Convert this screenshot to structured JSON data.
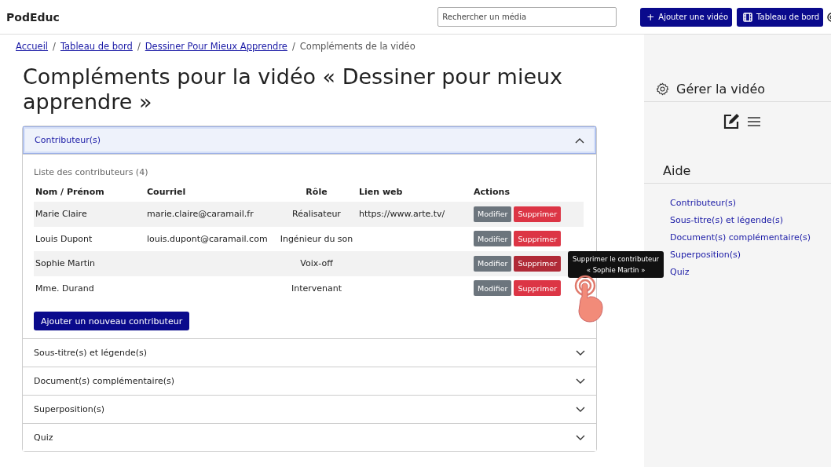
{
  "header": {
    "brand": "PodEduc",
    "search": {
      "placeholder": "Rechercher un média"
    },
    "buttons": [
      {
        "kind": "add",
        "icon": "+",
        "label": "Ajouter une vidéo"
      },
      {
        "kind": "dashboard",
        "label": "Tableau de bord"
      }
    ]
  },
  "breadcrumb": [
    {
      "label": "Accueil",
      "link": true
    },
    {
      "separator": "/",
      "label": "Tableau de bord",
      "link": true
    },
    {
      "separator": "/",
      "label": "Dessiner Pour Mieux Apprendre",
      "link": true
    },
    {
      "separator": "/",
      "label": "Compléments de la vidéo",
      "link": false
    }
  ],
  "title": "Compléments pour la vidéo « Dessiner pour mieux apprendre »",
  "accordion": [
    {
      "label": "Contributeur(s)",
      "expanded": true
    },
    {
      "label": "Sous-titre(s) et légende(s)",
      "expanded": false
    },
    {
      "label": "Document(s) complémentaire(s)",
      "expanded": false
    },
    {
      "label": "Superposition(s)",
      "expanded": false
    },
    {
      "label": "Quiz",
      "expanded": false
    }
  ],
  "contributors": {
    "caption": "Liste des contributeurs (4)",
    "columns": [
      "Nom / Prénom",
      "Courriel",
      "Rôle",
      "Lien web",
      "Actions"
    ],
    "rows": [
      {
        "name": "Marie Claire",
        "email": "marie.claire@caramail.fr",
        "role": "Réalisateur",
        "link": "https://www.arte.tv/",
        "edit": "Modifier",
        "delete": "Supprimer",
        "hovered": false
      },
      {
        "name": "Louis Dupont",
        "email": "louis.dupont@caramail.com",
        "role": "Ingénieur du son",
        "edit": "Modifier",
        "delete": "Supprimer",
        "hovered": false
      },
      {
        "name": "Sophie Martin",
        "role": "Voix-off",
        "edit": "Modifier",
        "delete": "Supprimer",
        "hovered": true,
        "tooltip": [
          "Supprimer le contributeur",
          "« Sophie Martin »"
        ]
      },
      {
        "name": "Mme. Durand",
        "role": "Intervenant",
        "edit": "Modifier",
        "delete": "Supprimer",
        "hovered": false
      }
    ],
    "add_button": "Ajouter un nouveau contributeur"
  },
  "sidebar": {
    "manage_title": "Gérer la vidéo",
    "help_title": "Aide",
    "help_links": [
      "Contributeur(s)",
      "Sous-titre(s) et légende(s)",
      "Document(s) complémentaire(s)",
      "Superposition(s)",
      "Quiz"
    ]
  }
}
